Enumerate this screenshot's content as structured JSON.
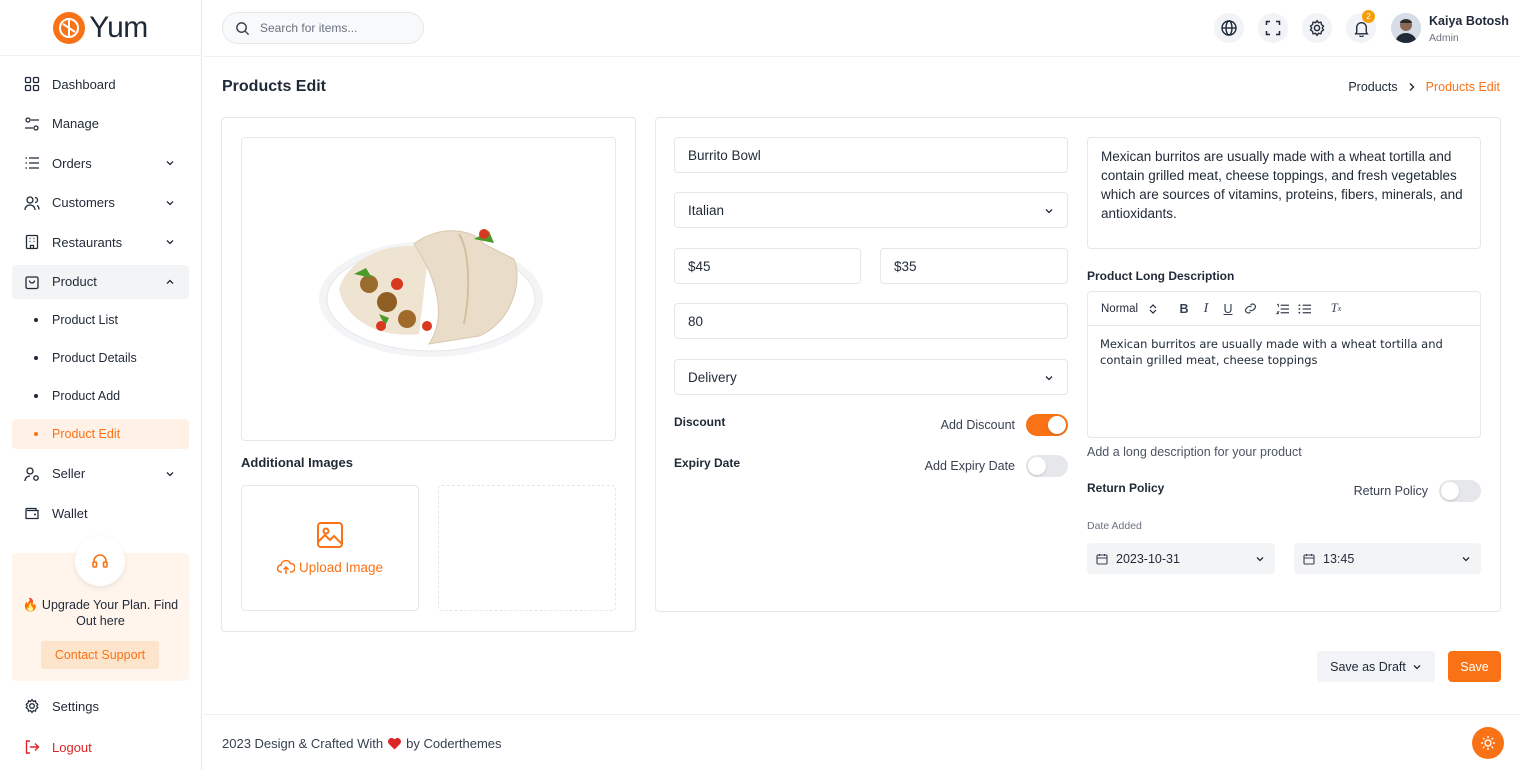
{
  "app": {
    "logo_text": "Yum"
  },
  "sidebar": {
    "items": [
      {
        "label": "Dashboard"
      },
      {
        "label": "Manage"
      },
      {
        "label": "Orders"
      },
      {
        "label": "Customers"
      },
      {
        "label": "Restaurants"
      },
      {
        "label": "Product"
      },
      {
        "label": "Seller"
      },
      {
        "label": "Wallet"
      }
    ],
    "product_sub": [
      {
        "label": "Product List"
      },
      {
        "label": "Product Details"
      },
      {
        "label": "Product Add"
      },
      {
        "label": "Product Edit"
      }
    ],
    "upgrade": {
      "text": "🔥 Upgrade Your Plan. Find Out here",
      "button": "Contact Support"
    },
    "settings_label": "Settings",
    "logout_label": "Logout"
  },
  "topbar": {
    "search_placeholder": "Search for items...",
    "notification_count": "2",
    "user_name": "Kaiya Botosh",
    "user_role": "Admin"
  },
  "page": {
    "title": "Products Edit",
    "breadcrumb": [
      "Products",
      "Products Edit"
    ]
  },
  "media": {
    "additional_images_label": "Additional Images",
    "upload_label": "Upload Image"
  },
  "form": {
    "name": "Burrito Bowl",
    "cuisine": "Italian",
    "price": "$45",
    "sale_price": "$35",
    "quantity": "80",
    "delivery": "Delivery",
    "discount_label": "Discount",
    "add_discount_label": "Add Discount",
    "discount_on": true,
    "expiry_label": "Expiry Date",
    "add_expiry_label": "Add Expiry Date",
    "expiry_on": false,
    "short_description": "Mexican burritos are usually made with a wheat tortilla and contain grilled meat, cheese toppings, and fresh vegetables which are sources of vitamins, proteins, fibers, minerals, and antioxidants.",
    "long_desc_label": "Product Long Description",
    "editor_format": "Normal",
    "long_description": "Mexican burritos are usually made with a wheat tortilla and contain grilled meat, cheese toppings",
    "long_desc_helper": "Add a long description for your product",
    "return_policy_label": "Return Policy",
    "return_policy_toggle_label": "Return Policy",
    "return_policy_on": false,
    "date_added_label": "Date Added",
    "date": "2023-10-31",
    "time": "13:45"
  },
  "actions": {
    "draft_label": "Save as Draft",
    "save_label": "Save"
  },
  "footer": {
    "text_before": "2023 Design & Crafted With",
    "text_after": "by Coderthemes"
  },
  "colors": {
    "accent": "#f97316",
    "border": "#e5e7eb"
  }
}
